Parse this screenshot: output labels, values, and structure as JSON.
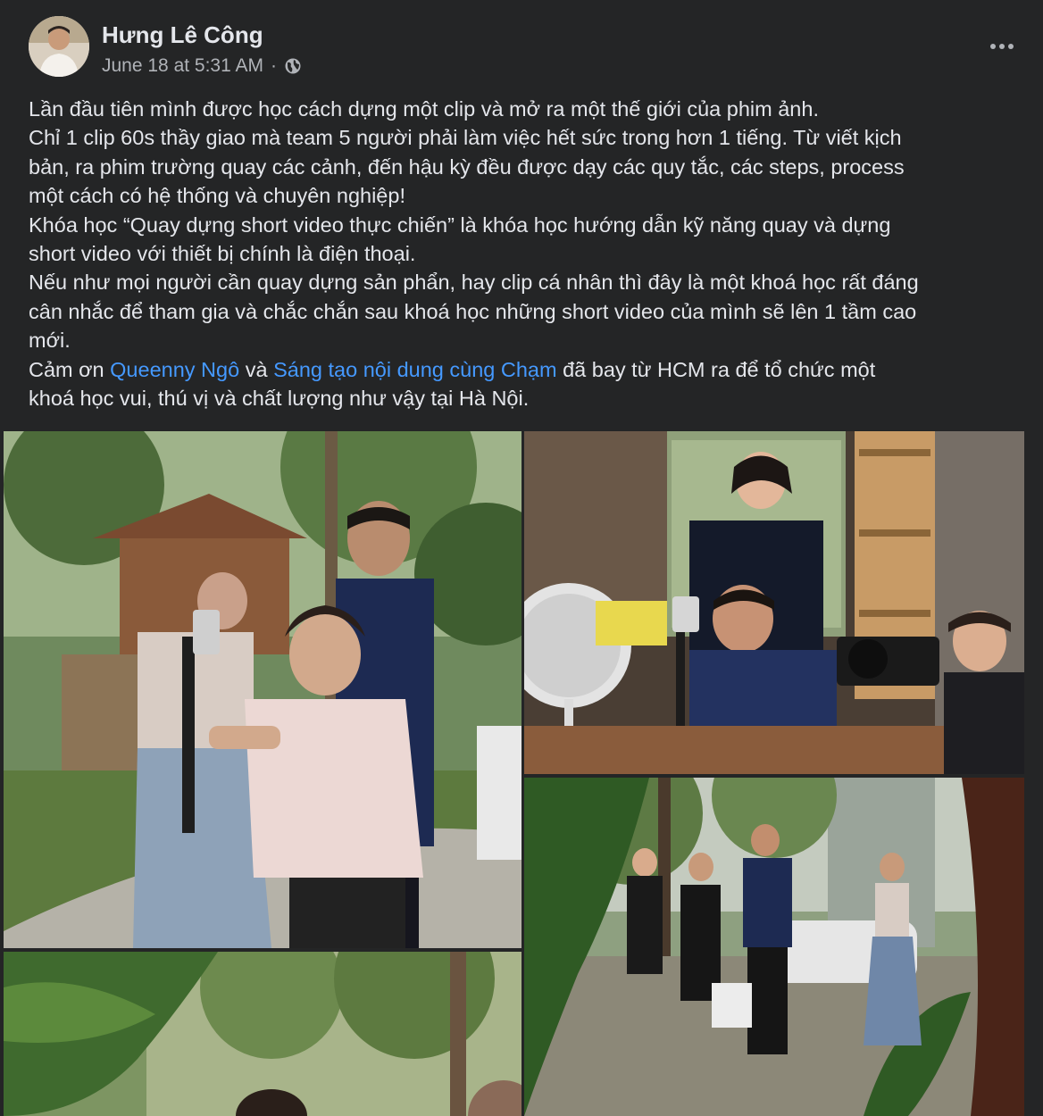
{
  "post": {
    "author": "Hưng Lê Công",
    "timestamp": "June 18 at 5:31 AM",
    "separator": "·",
    "privacy_icon": "globe-icon",
    "more_icon": "more-horizontal-icon"
  },
  "body": {
    "lines": [
      "Lần đầu tiên mình được học cách dựng một clip và mở ra một thế giới của phim ảnh.",
      "Chỉ 1 clip 60s thầy giao mà team 5 người phải làm việc hết sức trong hơn 1 tiếng. Từ viết kịch",
      "bản, ra phim trường quay các cảnh, đến hậu kỳ đều được dạy các quy tắc, các steps, process",
      "một cách có hệ thống và chuyên nghiệp!",
      "Khóa học  “Quay dựng short video thực chiến” là khóa học hướng dẫn kỹ năng quay và dựng",
      "short video với thiết bị chính là điện thoại.",
      "Nếu như mọi người cần quay dựng sản phẩn, hay clip cá nhân thì đây là một khoá học rất đáng",
      "cân nhắc để tham gia và chắc chắn sau khoá học những short video của mình sẽ lên 1 tầm cao",
      "mới."
    ],
    "thanks": {
      "prefix": "Cảm ơn ",
      "mention1": "Queenny Ngô",
      "and": " và ",
      "mention2": "Sáng tạo nội dung cùng Chạm",
      "suffix": " đã bay từ HCM ra để tổ chức một"
    },
    "last_line": "khoá học vui, thú vị và chất lượng như vậy tại Hà Nội."
  },
  "photos": [
    {
      "id": "photo-1"
    },
    {
      "id": "photo-2"
    },
    {
      "id": "photo-3"
    },
    {
      "id": "photo-4"
    }
  ],
  "colors": {
    "background": "#242526",
    "text": "#e4e6eb",
    "secondary": "#b0b3b8",
    "link": "#4599ff"
  }
}
